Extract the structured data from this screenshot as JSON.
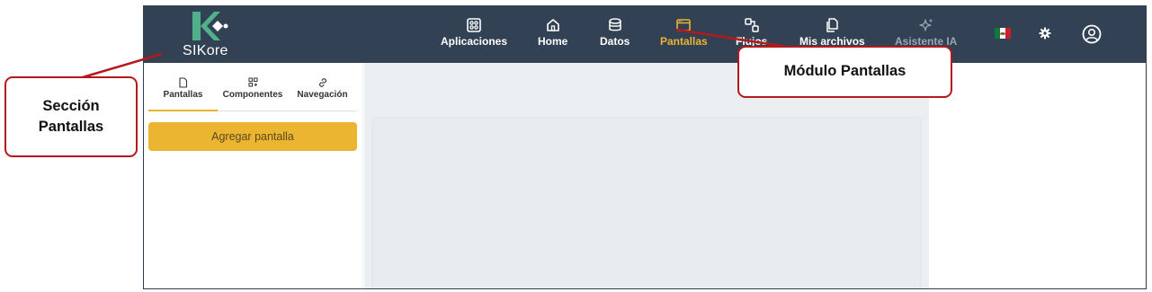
{
  "app": {
    "logo_text": "SIKore"
  },
  "nav": {
    "items": [
      {
        "label": "Aplicaciones",
        "icon": "apps-grid-icon",
        "state": "normal"
      },
      {
        "label": "Home",
        "icon": "home-icon",
        "state": "normal"
      },
      {
        "label": "Datos",
        "icon": "database-icon",
        "state": "normal"
      },
      {
        "label": "Pantallas",
        "icon": "window-icon",
        "state": "active"
      },
      {
        "label": "Flujos",
        "icon": "flow-icon",
        "state": "normal"
      },
      {
        "label": "Mis archivos",
        "icon": "files-icon",
        "state": "normal"
      },
      {
        "label": "Asistente IA",
        "icon": "sparkle-icon",
        "state": "disabled"
      }
    ],
    "language_flag": "mexico-flag-icon",
    "settings_icon": "gear-icon",
    "profile_icon": "user-circle-icon"
  },
  "sidebar": {
    "tabs": [
      {
        "label": "Pantallas",
        "icon": "file-icon"
      },
      {
        "label": "Componentes",
        "icon": "components-icon"
      },
      {
        "label": "Navegación",
        "icon": "link-icon"
      }
    ],
    "add_button": "Agregar pantalla"
  },
  "annotations": {
    "section": "Sección Pantallas",
    "module": "Módulo Pantallas"
  },
  "colors": {
    "topbar": "#334155",
    "accent": "#ebb531",
    "callout_border": "#b4191b",
    "logo_green": "#4fb08a"
  }
}
